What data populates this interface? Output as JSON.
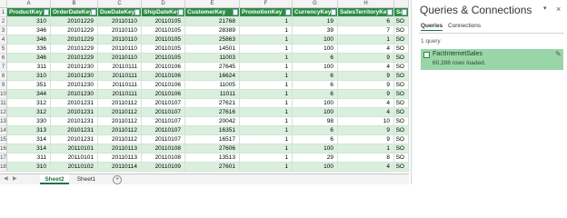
{
  "columns": [
    "A",
    "B",
    "C",
    "D",
    "E",
    "F",
    "G",
    "H"
  ],
  "headers": [
    "ProductKey",
    "OrderDateKey",
    "DueDateKey",
    "ShipDateKey",
    "CustomerKey",
    "PromotionKey",
    "CurrencyKey",
    "SalesTerritoryKey",
    "Sal"
  ],
  "rows": [
    [
      "310",
      "20101229",
      "20110110",
      "20110105",
      "21768",
      "1",
      "19",
      "6",
      "SO"
    ],
    [
      "346",
      "20101229",
      "20110110",
      "20110105",
      "28389",
      "1",
      "39",
      "7",
      "SO"
    ],
    [
      "346",
      "20101229",
      "20110110",
      "20110105",
      "25863",
      "1",
      "100",
      "1",
      "SO"
    ],
    [
      "336",
      "20101229",
      "20110110",
      "20110105",
      "14501",
      "1",
      "100",
      "4",
      "SO"
    ],
    [
      "346",
      "20101229",
      "20110110",
      "20110105",
      "11003",
      "1",
      "6",
      "9",
      "SO"
    ],
    [
      "311",
      "20101230",
      "20110111",
      "20110106",
      "27645",
      "1",
      "100",
      "4",
      "SO"
    ],
    [
      "310",
      "20101230",
      "20110111",
      "20110106",
      "16624",
      "1",
      "6",
      "9",
      "SO"
    ],
    [
      "351",
      "20101230",
      "20110111",
      "20110106",
      "11005",
      "1",
      "6",
      "9",
      "SO"
    ],
    [
      "344",
      "20101230",
      "20110111",
      "20110106",
      "11011",
      "1",
      "6",
      "9",
      "SO"
    ],
    [
      "312",
      "20101231",
      "20110112",
      "20110107",
      "27621",
      "1",
      "100",
      "4",
      "SO"
    ],
    [
      "312",
      "20101231",
      "20110112",
      "20110107",
      "27616",
      "1",
      "100",
      "4",
      "SO"
    ],
    [
      "330",
      "20101231",
      "20110112",
      "20110107",
      "20042",
      "1",
      "98",
      "10",
      "SO"
    ],
    [
      "313",
      "20101231",
      "20110112",
      "20110107",
      "16351",
      "1",
      "6",
      "9",
      "SO"
    ],
    [
      "314",
      "20101231",
      "20110112",
      "20110107",
      "16517",
      "1",
      "6",
      "9",
      "SO"
    ],
    [
      "314",
      "20110101",
      "20110113",
      "20110108",
      "27606",
      "1",
      "100",
      "1",
      "SO"
    ],
    [
      "311",
      "20110101",
      "20110113",
      "20110108",
      "13513",
      "1",
      "29",
      "8",
      "SO"
    ],
    [
      "310",
      "20110102",
      "20110114",
      "20110109",
      "27601",
      "1",
      "100",
      "4",
      "SO"
    ]
  ],
  "row_numbers": [
    "1",
    "2",
    "3",
    "4",
    "5",
    "6",
    "7",
    "8",
    "9",
    "10",
    "11",
    "12",
    "13",
    "14",
    "15",
    "16",
    "17",
    "18"
  ],
  "sheet_tabs": {
    "active": "Sheet2",
    "other": "Sheet1",
    "add": "+"
  },
  "pane": {
    "title": "Queries & Connections",
    "close": "×",
    "tabs": [
      "Queries",
      "Connections"
    ],
    "query_count": "1 query",
    "query_name": "FactInternetSales",
    "query_rows": "60,398 rows loaded."
  },
  "colors": {
    "header_green": "#2e8b46",
    "band_green": "#dbefdf",
    "selected_query": "#9ad5a8"
  }
}
